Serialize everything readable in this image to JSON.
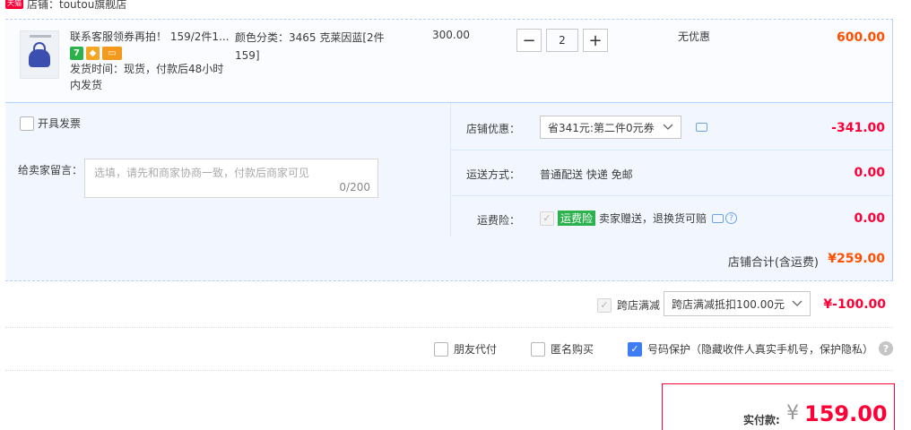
{
  "shop": {
    "badge": "天猫",
    "name": "店铺：toutou旗舰店"
  },
  "item": {
    "title": "联系客服领券再拍！ 159/2件1...",
    "shipping_time": "发货时间：现货，付款后48小时内发货",
    "sku": "颜色分类：3465 克莱因蓝[2件159]",
    "unit_price": "300.00",
    "quantity": "2",
    "qty_minus": "−",
    "qty_plus": "+",
    "promotion": "无优惠",
    "subtotal": "600.00",
    "badges": {
      "seven": "7",
      "shield": "◆",
      "card": "▭"
    }
  },
  "options": {
    "invoice_label": "开具发票",
    "message_label": "给卖家留言：",
    "message_placeholder": "选填，请先和商家协商一致，付款后商家可见",
    "message_count": "0/200",
    "store_discount_label": "店铺优惠：",
    "store_discount_value": "省341元:第二件0元券",
    "store_discount_amount": "-341.00",
    "shipping_label": "运送方式：",
    "shipping_value": "普通配送 快递 免邮",
    "shipping_amount": "0.00",
    "insurance_label": "运费险：",
    "insurance_tag": "运费险",
    "insurance_desc": "卖家赠送，退换货可赔",
    "insurance_amount": "0.00"
  },
  "shop_total": {
    "label": "店铺合计(含运费)",
    "value": "¥259.00"
  },
  "cross_store": {
    "label": "跨店满减",
    "select_value": "跨店满减抵扣100.00元",
    "amount": "¥-100.00"
  },
  "services": {
    "friend_pay": "朋友代付",
    "anonymous": "匿名购买",
    "number_protect": "号码保护（隐藏收件人真实手机号，保护隐私）"
  },
  "payment": {
    "label": "实付款:",
    "currency": "¥",
    "amount": "159.00"
  },
  "colors": {
    "accent": "#ff0036",
    "orange": "#ff5000",
    "border_blue": "#b2d1ff",
    "panel_bg": "#f2f7ff",
    "check_blue": "#3d7cf3"
  }
}
